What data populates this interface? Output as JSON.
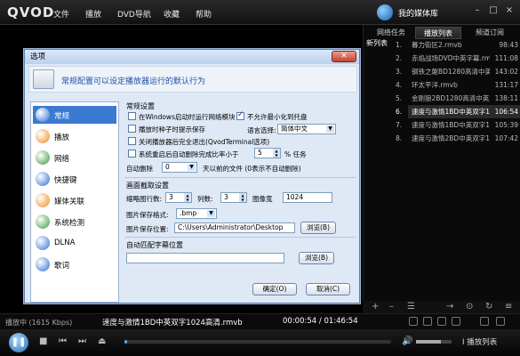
{
  "app": {
    "logo": "QVOD",
    "menu": [
      "文件",
      "播放",
      "DVD导航",
      "收藏",
      "帮助"
    ],
    "media_library": "我的媒体库",
    "window_controls": [
      "–",
      "□",
      "×"
    ]
  },
  "right_panel": {
    "tabs": [
      "网络任务",
      "播放列表",
      "频道订阅"
    ],
    "new_list": "新列表",
    "items": [
      {
        "num": "1.",
        "title": "暮力街区2.rmvb",
        "dur": "98:43"
      },
      {
        "num": "2.",
        "title": "赤焰战场DVD中英字幕.rmvb",
        "dur": "111:08"
      },
      {
        "num": "3.",
        "title": "钢铁之躯BD1280高清中英双字.rmvb",
        "dur": "143:02"
      },
      {
        "num": "4.",
        "title": "环太平洋.rmvb",
        "dur": "131:17"
      },
      {
        "num": "5.",
        "title": "金刚狼2BD1280高清中英双字.rmvb",
        "dur": "138:11"
      },
      {
        "num": "6.",
        "title": "速度与激情1BD中英双字1024高清.rmvb",
        "dur": "106:54"
      },
      {
        "num": "7.",
        "title": "速度与激情1BD中英双字1024高清.rmvb",
        "dur": "105:39"
      },
      {
        "num": "8.",
        "title": "速度与激情2BD中英双字1024高清.rmvb",
        "dur": "107:42"
      }
    ],
    "active_index": 5,
    "bottom_controls": [
      "+",
      "–",
      "☰",
      "→",
      "⊙",
      "↻",
      "≡"
    ]
  },
  "status": {
    "state": "播放中 (1615 Kbps)",
    "filename": "速度与激情1BD中英双字1024高清.rmvb",
    "time": "00:00:54 / 01:46:54"
  },
  "controls": {
    "play_icon": "❚❚",
    "stop": "■",
    "prev": "⏮",
    "next": "⏭",
    "eject": "⏏",
    "progress": 0.0084,
    "volume": 0.7,
    "volume_icon": "🔊",
    "open_playlist": "Ⅰ 播放列表"
  },
  "dialog": {
    "title": "选项",
    "close": "✕",
    "header": "常规配置可以设定播放器运行的默认行为",
    "nav": [
      {
        "label": "常规",
        "color": "#2b6fd6"
      },
      {
        "label": "播放",
        "color": "#f08a1a"
      },
      {
        "label": "网络",
        "color": "#3b9a3b"
      },
      {
        "label": "快捷键",
        "color": "#2b6fd6"
      },
      {
        "label": "媒体关联",
        "color": "#f08a1a"
      },
      {
        "label": "系统检测",
        "color": "#3b9a3b"
      },
      {
        "label": "DLNA",
        "color": "#2b6fd6"
      },
      {
        "label": "歌词",
        "color": "#2b6fd6"
      }
    ],
    "nav_selected": 0,
    "general": {
      "section": "常规设置",
      "opt1": "在Windows启动时运行网络模块",
      "opt2": "不允许最小化到托盘",
      "opt3": "播放时种子时提示保存",
      "lang_label": "语言选择:",
      "lang_value": "简体中文",
      "opt4": "关闭播放器后完全退出(QvodTerminal选项)",
      "opt5": "系统重启后自动删除完成比率小于",
      "opt5_value": "5",
      "opt5_suffix": "% 任务",
      "autodel_label": "自动删除",
      "autodel_value": "0",
      "autodel_suffix": "天以前的文件 (0表示不自动删除)"
    },
    "capture": {
      "section": "画面截取设置",
      "rows_label": "缩略图行数:",
      "rows_value": "3",
      "cols_label": "列数:",
      "cols_value": "3",
      "width_label": "图像宽",
      "width_value": "1024",
      "format_label": "图片保存格式:",
      "format_value": ".bmp",
      "path_label": "图片保存位置:",
      "path_value": "C:\\Users\\Administrator\\Desktop",
      "browse": "浏览(B)"
    },
    "subtitle": {
      "section": "自动匹配字幕位置",
      "path_value": "",
      "browse": "浏览(B)"
    },
    "ok": "确定(O)",
    "cancel": "取消(C)"
  }
}
